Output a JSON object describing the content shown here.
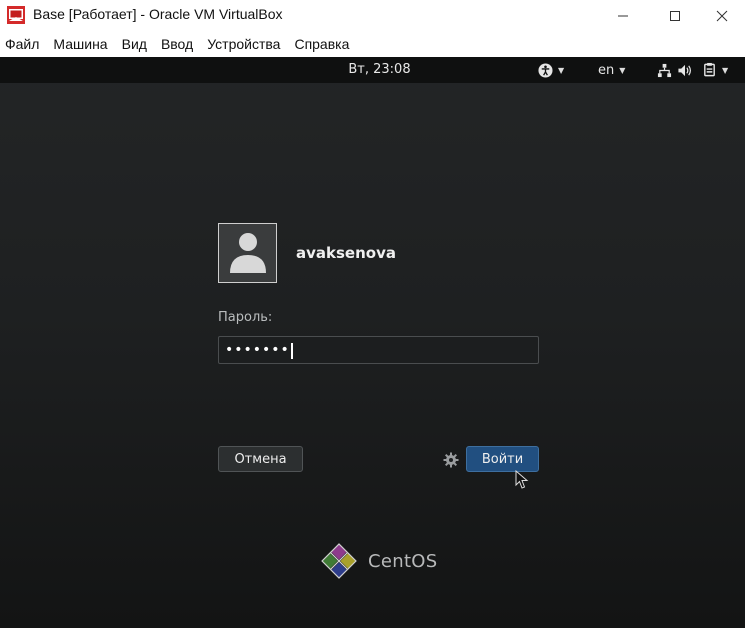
{
  "window": {
    "title": "Base [Работает] - Oracle VM VirtualBox",
    "minimize_glyph": "—",
    "maximize_glyph": "☐",
    "close_glyph": "✕"
  },
  "menubar": {
    "items": [
      "Файл",
      "Машина",
      "Вид",
      "Ввод",
      "Устройства",
      "Справка"
    ]
  },
  "topbar": {
    "clock": "Вт, 23:08",
    "language": "en",
    "icons": [
      "accessibility-icon",
      "network-icon",
      "volume-icon",
      "power-icon"
    ]
  },
  "login": {
    "username": "avaksenova",
    "password_label": "Пароль:",
    "password_mask": "•••••••",
    "cancel_label": "Отмена",
    "login_label": "Войти"
  },
  "branding": {
    "name": "CentOS"
  },
  "colors": {
    "screen_bg": "#1e2021",
    "topbar_bg": "#0f1010",
    "login_button": "#214f80",
    "cancel_button": "#2c2f30"
  }
}
